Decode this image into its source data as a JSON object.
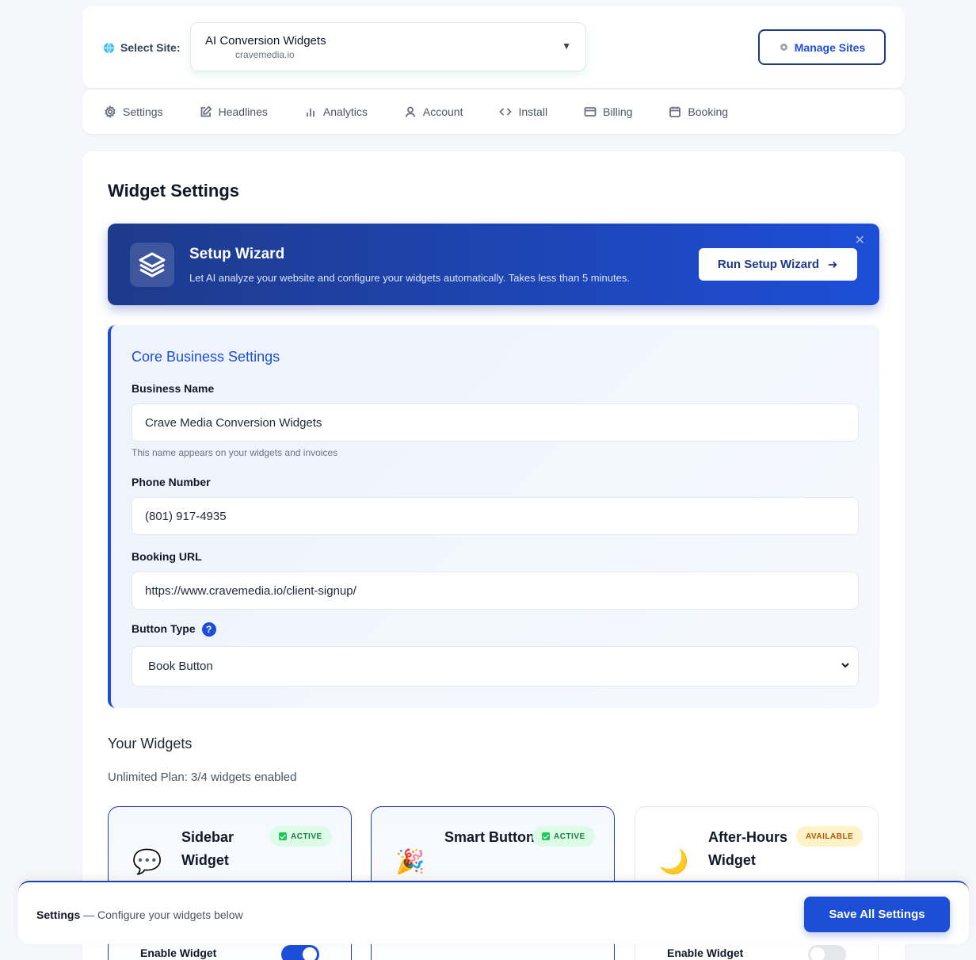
{
  "site_selector": {
    "label": "Select Site:",
    "selected_name": "AI Conversion Widgets",
    "selected_domain": "cravemedia.io",
    "manage_label": "Manage Sites"
  },
  "nav": {
    "items": [
      {
        "label": "Settings",
        "icon": "gear-icon"
      },
      {
        "label": "Headlines",
        "icon": "edit-icon"
      },
      {
        "label": "Analytics",
        "icon": "bar-chart-icon"
      },
      {
        "label": "Account",
        "icon": "user-icon"
      },
      {
        "label": "Install",
        "icon": "code-icon"
      },
      {
        "label": "Billing",
        "icon": "credit-card-icon"
      },
      {
        "label": "Booking",
        "icon": "calendar-icon"
      }
    ]
  },
  "page": {
    "title": "Widget Settings"
  },
  "wizard": {
    "title": "Setup Wizard",
    "description": "Let AI analyze your website and configure your widgets automatically. Takes less than 5 minutes.",
    "button_label": "Run Setup Wizard",
    "close_glyph": "✕"
  },
  "core": {
    "title": "Core Business Settings",
    "business_name_label": "Business Name",
    "business_name_value": "Crave Media Conversion Widgets",
    "business_name_hint": "This name appears on your widgets and invoices",
    "phone_label": "Phone Number",
    "phone_value": "(801) 917-4935",
    "booking_url_label": "Booking URL",
    "booking_url_value": "https://www.cravemedia.io/client-signup/",
    "button_type_label": "Button Type",
    "button_type_help": "?",
    "button_type_value": "Book Button"
  },
  "widgets": {
    "title": "Your Widgets",
    "plan_text": "Unlimited Plan: 3/4 widgets enabled",
    "cards": [
      {
        "title": "Sidebar Widget",
        "badge": "ACTIVE",
        "emoji": "💬",
        "toggle_label": "Enable Widget",
        "enabled": true
      },
      {
        "title": "Smart Button",
        "badge": "ACTIVE",
        "emoji": "🎉",
        "toggle_label": "",
        "enabled": true
      },
      {
        "title": "After-Hours Widget",
        "badge": "AVAILABLE",
        "emoji": "🌙",
        "toggle_label": "Enable Widget",
        "enabled": false
      }
    ]
  },
  "bottom_bar": {
    "strong": "Settings",
    "rest": " — Configure your widgets below",
    "save_label": "Save All Settings"
  },
  "colors": {
    "accent": "#1d4ed8",
    "wizard_gradient_start": "#1e3a8a",
    "active_badge": "#15803d",
    "available_badge": "#b45309"
  }
}
